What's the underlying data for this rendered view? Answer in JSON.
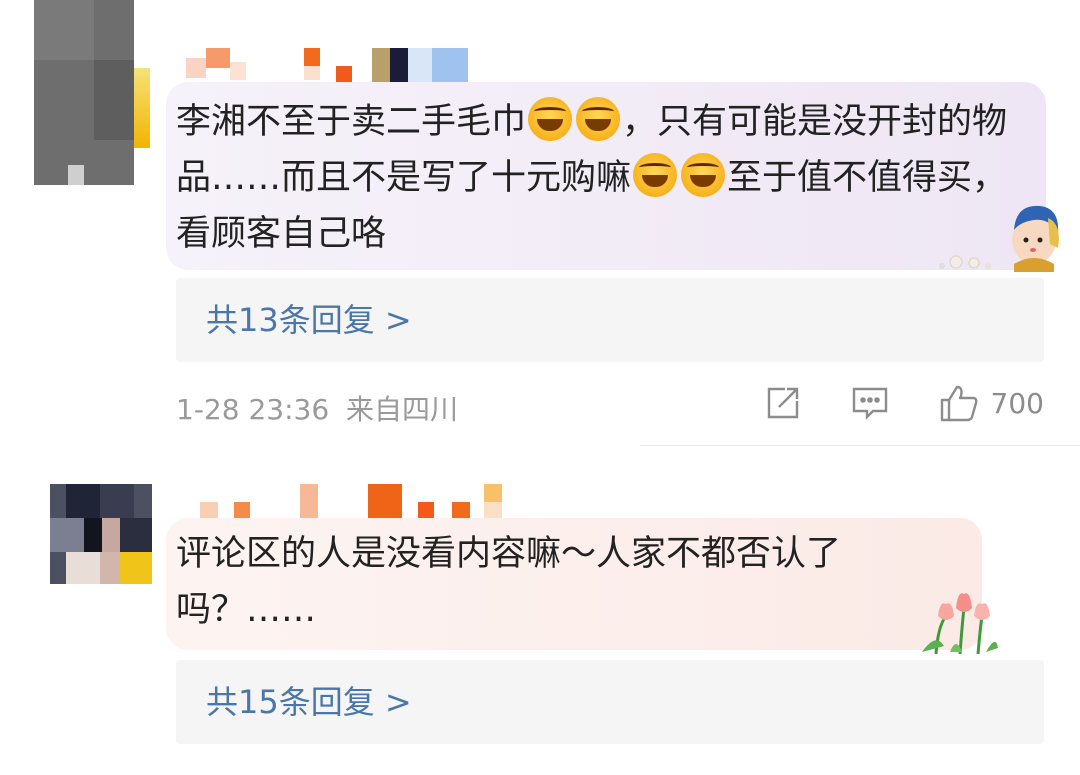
{
  "comments": [
    {
      "text_before_emoji": "李湘不至于卖二手毛巾",
      "text_middle": "，只有可能是没开封的物品……而且不是写了十元购嘛",
      "text_after": "至于值不值得买，看顾客自己咯",
      "replies_label": "共13条回复 >",
      "timestamp": "1-28 23:36",
      "location": "来自四川",
      "like_count": "700",
      "emoji_name": "laugh-cry-emoji",
      "sticker_name": "girl-with-pearl-earring-sticker",
      "bubble_color": "#f3eef8"
    },
    {
      "text": "评论区的人是没看内容嘛～人家不都否认了吗？……",
      "replies_label": "共15条回复 >",
      "sticker_name": "tulip-sticker",
      "bubble_color": "#fdf1ef"
    }
  ],
  "icons": {
    "repost": "repost-icon",
    "comment": "comment-icon",
    "like": "thumbs-up-icon"
  },
  "colors": {
    "link_blue": "#4a76a8",
    "meta_gray": "#9a9a9a"
  }
}
